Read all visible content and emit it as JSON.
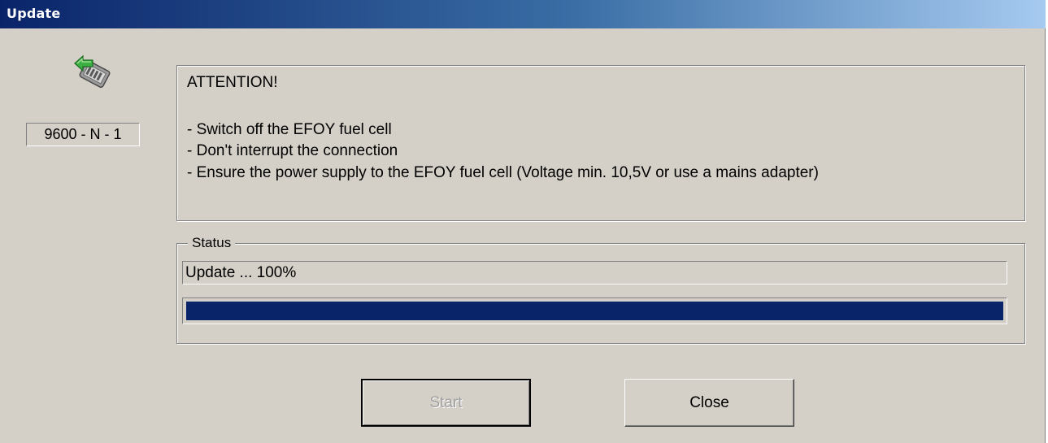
{
  "window": {
    "title": "Update"
  },
  "device": {
    "icon": "device-update-icon",
    "label": "9600 - N - 1"
  },
  "attention": {
    "heading": "ATTENTION!",
    "lines": [
      "- Switch off the EFOY fuel cell",
      "- Don't interrupt the connection",
      "- Ensure the power supply to the EFOY fuel cell (Voltage min. 10,5V or use a mains adapter)"
    ]
  },
  "status": {
    "legend": "Status",
    "text": "Update ... 100%",
    "progress_percent": 100,
    "progress_color": "#0a246a"
  },
  "buttons": {
    "start_label": "Start",
    "start_enabled": false,
    "close_label": "Close"
  },
  "colors": {
    "dialog_background": "#d4d0c8",
    "title_gradient_start": "#0a246a",
    "title_gradient_end": "#a6caf0"
  }
}
